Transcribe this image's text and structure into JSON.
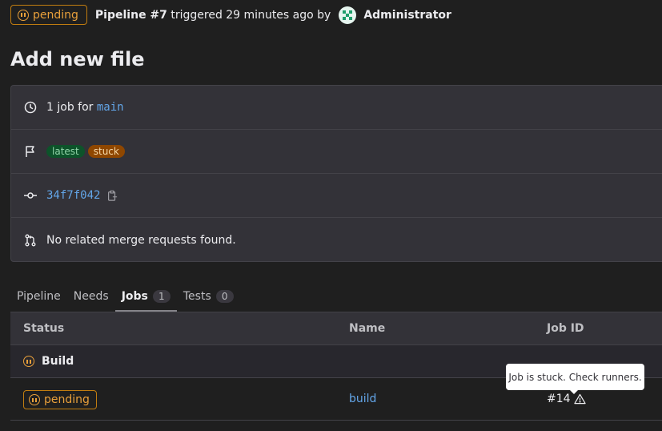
{
  "header": {
    "status": "pending",
    "pipeline": "Pipeline #7",
    "triggered_text": "triggered 29 minutes ago by",
    "author": "Administrator"
  },
  "page_title": "Add new file",
  "info": {
    "jobs_prefix": "1 job for",
    "branch": "main",
    "badges": [
      "latest",
      "stuck"
    ],
    "commit_sha": "34f7f042",
    "merge_requests": "No related merge requests found."
  },
  "tabs": [
    {
      "label": "Pipeline"
    },
    {
      "label": "Needs"
    },
    {
      "label": "Jobs",
      "count": "1"
    },
    {
      "label": "Tests",
      "count": "0"
    }
  ],
  "table": {
    "headers": [
      "Status",
      "Name",
      "Job ID"
    ],
    "stage": "Build",
    "jobs": [
      {
        "status": "pending",
        "name": "build",
        "job_id": "#14"
      }
    ]
  },
  "tooltip": "Job is stuck. Check runners.",
  "colors": {
    "pending": "#e9a03b",
    "link": "#63a6e9",
    "background": "#1f1f1f",
    "card": "#333238"
  }
}
